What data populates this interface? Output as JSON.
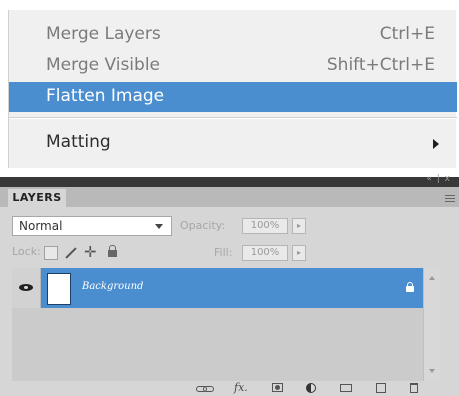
{
  "menu": {
    "items": [
      {
        "label": "Merge Layers",
        "shortcut": "Ctrl+E"
      },
      {
        "label": "Merge Visible",
        "shortcut": "Shift+Ctrl+E"
      },
      {
        "label": "Flatten Image",
        "shortcut": ""
      },
      {
        "label": "Matting",
        "shortcut": ""
      }
    ],
    "selected": "Flatten Image",
    "accent_color": "#4b8ed0"
  },
  "panel": {
    "tab_label": "LAYERS",
    "blend_mode": "Normal",
    "opacity_label": "Opacity:",
    "opacity_value": "100%",
    "lock_label": "Lock:",
    "fill_label": "Fill:",
    "fill_value": "100%",
    "icons": {
      "collapse": "double-chevron-collapse-icon",
      "panel_menu": "panel-menu-icon",
      "visibility": "eye-icon",
      "lock": "lock-icon"
    },
    "layers": [
      {
        "name": "Background",
        "selected": true,
        "locked": true,
        "visible": true
      }
    ],
    "toolbar_icons": [
      "link-layers-icon",
      "fx-icon",
      "layer-mask-icon",
      "adjustment-layer-icon",
      "new-group-icon",
      "new-layer-icon",
      "delete-layer-icon"
    ]
  }
}
